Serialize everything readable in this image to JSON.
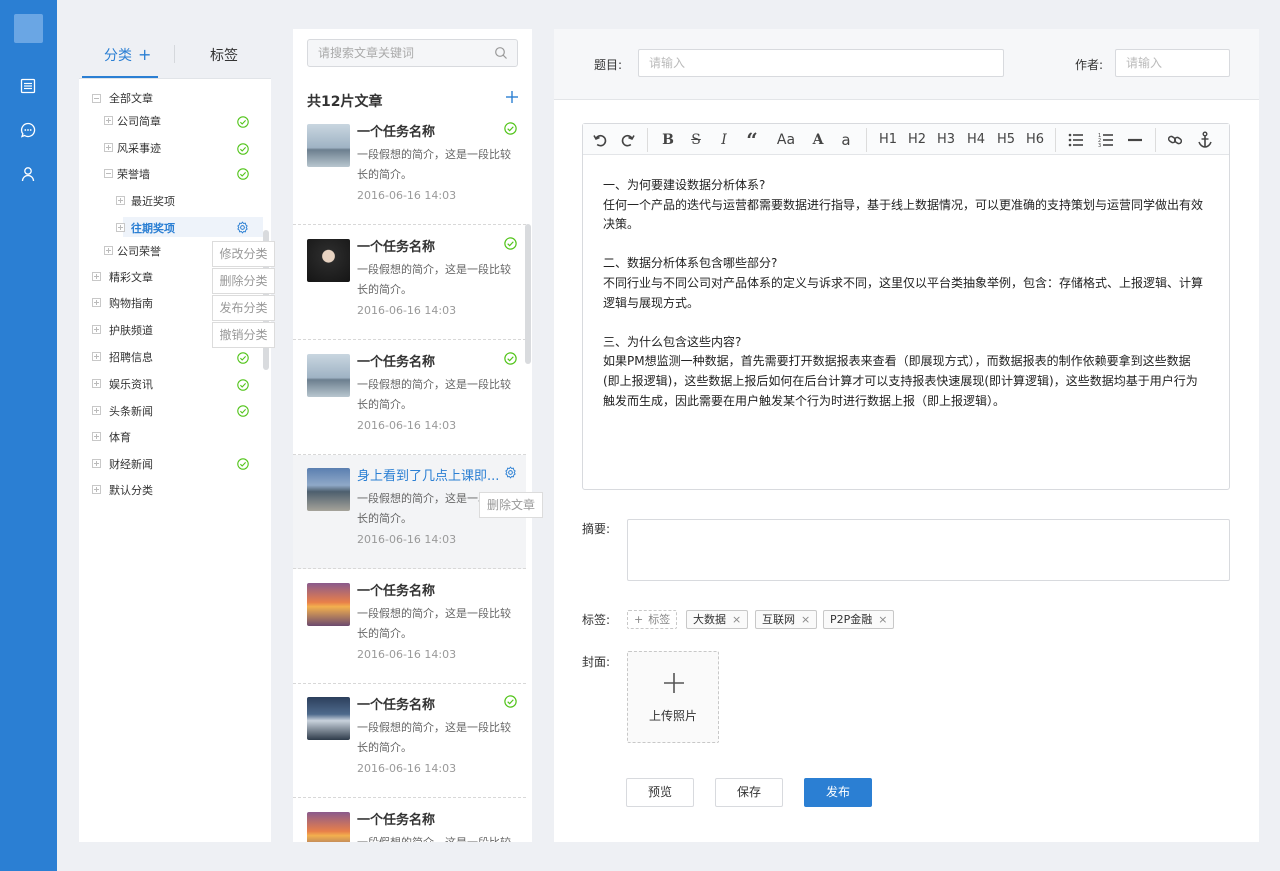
{
  "sidebar_tabs": {
    "category": "分类",
    "tags": "标签"
  },
  "category_tree": [
    {
      "label": "全部文章",
      "checked": false
    },
    {
      "label": "公司简章",
      "checked": true
    },
    {
      "label": "风采事迹",
      "checked": true
    },
    {
      "label": "荣誉墙",
      "checked": true
    },
    {
      "label": "最近奖项",
      "checked": false
    },
    {
      "label": "往期奖项",
      "checked": false,
      "selected": true
    },
    {
      "label": "公司荣誉",
      "checked": false
    },
    {
      "label": "精彩文章",
      "checked": false
    },
    {
      "label": "购物指南",
      "checked": false
    },
    {
      "label": "护肤频道",
      "checked": false
    },
    {
      "label": "招聘信息",
      "checked": true
    },
    {
      "label": "娱乐资讯",
      "checked": true
    },
    {
      "label": "头条新闻",
      "checked": true
    },
    {
      "label": "体育",
      "checked": false
    },
    {
      "label": "财经新闻",
      "checked": true
    },
    {
      "label": "默认分类",
      "checked": false
    }
  ],
  "category_menu": [
    "修改分类",
    "删除分类",
    "发布分类",
    "撤销分类"
  ],
  "article_list": {
    "search_placeholder": "请搜索文章关键词",
    "title": "共12片文章",
    "items": [
      {
        "title": "一个任务名称",
        "desc": "一段假想的简介，这是一段比较长的简介。",
        "date": "2016-06-16  14:03",
        "status": "check"
      },
      {
        "title": "一个任务名称",
        "desc": "一段假想的简介，这是一段比较长的简介。",
        "date": "2016-06-16  14:03",
        "status": "check"
      },
      {
        "title": "一个任务名称",
        "desc": "一段假想的简介，这是一段比较长的简介。",
        "date": "2016-06-16  14:03",
        "status": "check"
      },
      {
        "title": "身上看到了几点上课即...",
        "desc": "一段假想的简介，这是一段比较长的简介。",
        "date": "2016-06-16  14:03",
        "status": "gear"
      },
      {
        "title": "一个任务名称",
        "desc": "一段假想的简介，这是一段比较长的简介。",
        "date": "2016-06-16  14:03",
        "status": "none"
      },
      {
        "title": "一个任务名称",
        "desc": "一段假想的简介，这是一段比较长的简介。",
        "date": "2016-06-16  14:03",
        "status": "check"
      },
      {
        "title": "一个任务名称",
        "desc": "一段假想的简介，这是一段比较长的简介。",
        "date": "",
        "status": "none"
      }
    ],
    "delete_tooltip": "删除文章"
  },
  "editor": {
    "title_label": "题目:",
    "title_placeholder": "请输入",
    "author_label": "作者:",
    "author_placeholder": "请输入",
    "toolbar": [
      "undo",
      "redo",
      "B",
      "S",
      "I",
      "“",
      "Aa",
      "A",
      "a",
      "H1",
      "H2",
      "H3",
      "H4",
      "H5",
      "H6",
      "bullet-list",
      "numbered-list",
      "hr",
      "link",
      "anchor"
    ],
    "content": [
      "一、为何要建设数据分析体系?",
      "任何一个产品的迭代与运营都需要数据进行指导，基于线上数据情况，可以更准确的支持策划与运营同学做出有效决策。",
      "",
      "二、数据分析体系包含哪些部分?",
      "不同行业与不同公司对产品体系的定义与诉求不同，这里仅以平台类抽象举例，包含：存储格式、上报逻辑、计算逻辑与展现方式。",
      "",
      "三、为什么包含这些内容?",
      "如果PM想监测一种数据，首先需要打开数据报表来查看（即展现方式），而数据报表的制作依赖要拿到这些数据(即上报逻辑)，这些数据上报后如何在后台计算才可以支持报表快速展现(即计算逻辑)，这些数据均基于用户行为触发而生成，因此需要在用户触发某个行为时进行数据上报（即上报逻辑）。"
    ],
    "summary_label": "摘要:",
    "tags_label": "标签:",
    "add_tag": "标签",
    "tags": [
      "大数据",
      "互联网",
      "P2P金融"
    ],
    "cover_label": "封面:",
    "upload_label": "上传照片",
    "buttons": {
      "preview": "预览",
      "save": "保存",
      "publish": "发布"
    }
  },
  "colors": {
    "accent": "#2b7fd3",
    "success": "#52c41a",
    "nav_bg": "#2b7fd3"
  }
}
